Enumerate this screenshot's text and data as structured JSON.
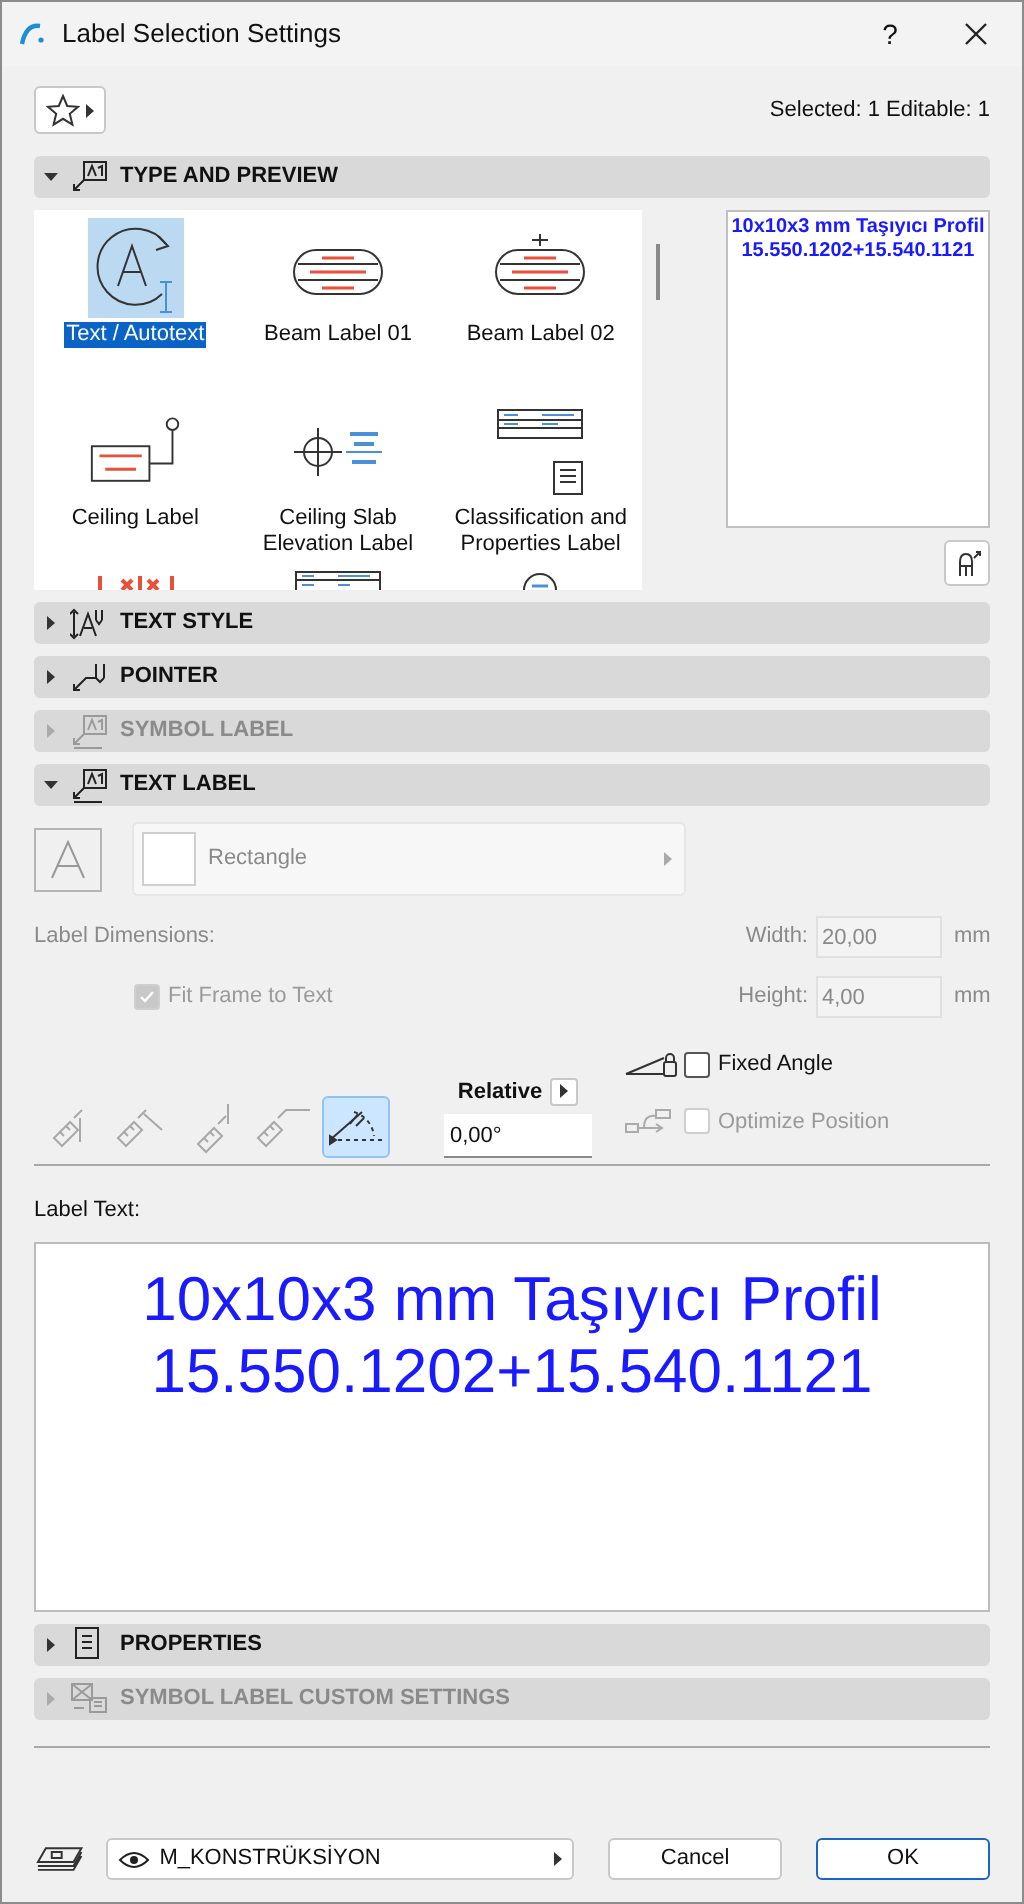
{
  "window": {
    "title": "Label Selection Settings",
    "help": "?"
  },
  "selection_info": "Selected: 1 Editable: 1",
  "type_and_preview": {
    "header": {
      "label": "TYPE AND PREVIEW",
      "kind": "type_preview",
      "expanded": true,
      "disabled": false
    },
    "gallery": [
      {
        "label": "Text / Autotext",
        "kind": "autotext",
        "selected": true
      },
      {
        "label": "Beam Label 01",
        "kind": "beam1",
        "selected": false
      },
      {
        "label": "Beam Label 02",
        "kind": "beam2",
        "selected": false
      },
      {
        "label": "Ceiling Label",
        "kind": "ceiling",
        "selected": false
      },
      {
        "label": "Ceiling Slab Elevation Label",
        "kind": "elevation",
        "selected": false
      },
      {
        "label": "Classification and Properties Label",
        "kind": "classification",
        "selected": false
      },
      {
        "kind": "dims",
        "selected": false
      },
      {
        "kind": "table",
        "selected": false
      },
      {
        "kind": "circle",
        "selected": false
      }
    ],
    "preview_lines": [
      "10x10x3 mm Taşıyıcı Profil",
      "15.550.1202+15.540.1121"
    ]
  },
  "collapsed_sections": [
    {
      "label": "TEXT STYLE",
      "kind": "text_style",
      "expanded": false,
      "disabled": false
    },
    {
      "label": "POINTER",
      "kind": "pointer",
      "expanded": false,
      "disabled": false
    },
    {
      "label": "SYMBOL LABEL",
      "kind": "symbol_label",
      "expanded": false,
      "disabled": true
    }
  ],
  "text_label": {
    "header": {
      "label": "TEXT LABEL",
      "kind": "text_label",
      "expanded": true,
      "disabled": false
    },
    "frame_shape": "Rectangle",
    "dimensions_label": "Label Dimensions:",
    "width": {
      "label": "Width:",
      "value": "20,00",
      "unit": "mm"
    },
    "height": {
      "label": "Height:",
      "value": "4,00",
      "unit": "mm"
    },
    "fit_frame": {
      "label": "Fit Frame to Text",
      "checked": true,
      "disabled": true
    },
    "orientations": [
      {
        "kind": "vertical_down",
        "selected": false
      },
      {
        "kind": "diagonal",
        "selected": false
      },
      {
        "kind": "vertical_up",
        "selected": false
      },
      {
        "kind": "horizontal",
        "selected": false
      },
      {
        "kind": "custom_angle",
        "selected": true
      }
    ],
    "angle_mode": "Relative",
    "angle": "0,00°",
    "fixed_angle": {
      "label": "Fixed Angle",
      "checked": false,
      "disabled": false
    },
    "optimize_position": {
      "label": "Optimize Position",
      "checked": false,
      "disabled": true
    }
  },
  "label_text": {
    "label": "Label Text:",
    "lines": [
      "10x10x3 mm Taşıyıcı Profil",
      "15.550.1202+15.540.1121"
    ]
  },
  "bottom_sections": [
    {
      "label": "PROPERTIES",
      "kind": "properties",
      "expanded": false,
      "disabled": false
    },
    {
      "label": "SYMBOL LABEL CUSTOM SETTINGS",
      "kind": "symbol_custom",
      "expanded": false,
      "disabled": true
    }
  ],
  "footer": {
    "layer": "M_KONSTRÜKSİYON",
    "buttons": [
      {
        "label": "Cancel",
        "default": false
      },
      {
        "label": "OK",
        "default": true
      }
    ]
  }
}
